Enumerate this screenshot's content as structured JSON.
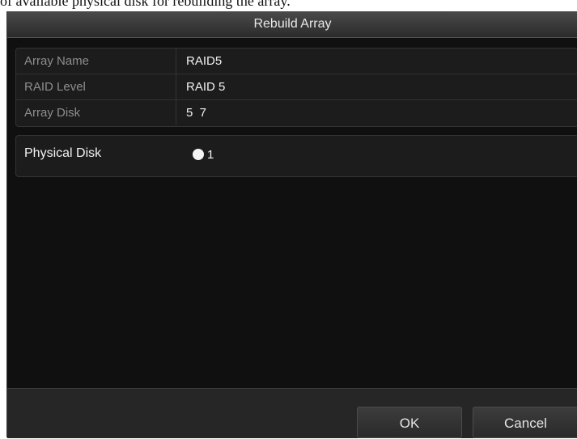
{
  "background_text": "of available physical disk for rebuilding the array.",
  "dialog": {
    "title": "Rebuild Array"
  },
  "array_info": {
    "rows": [
      {
        "label": "Array Name",
        "value": "RAID5"
      },
      {
        "label": "RAID Level",
        "value": "RAID 5"
      },
      {
        "label": "Array Disk",
        "value": "5  7"
      }
    ]
  },
  "physical_disk": {
    "label": "Physical Disk",
    "options": [
      {
        "label": "1",
        "selected": false
      }
    ]
  },
  "buttons": {
    "ok": "OK",
    "cancel": "Cancel"
  },
  "colors": {
    "dialog_bg": "#0c0c0c",
    "panel_bg": "#1c1c1c",
    "label_muted": "#8e8e8e",
    "text_light": "#f2f2f2"
  }
}
